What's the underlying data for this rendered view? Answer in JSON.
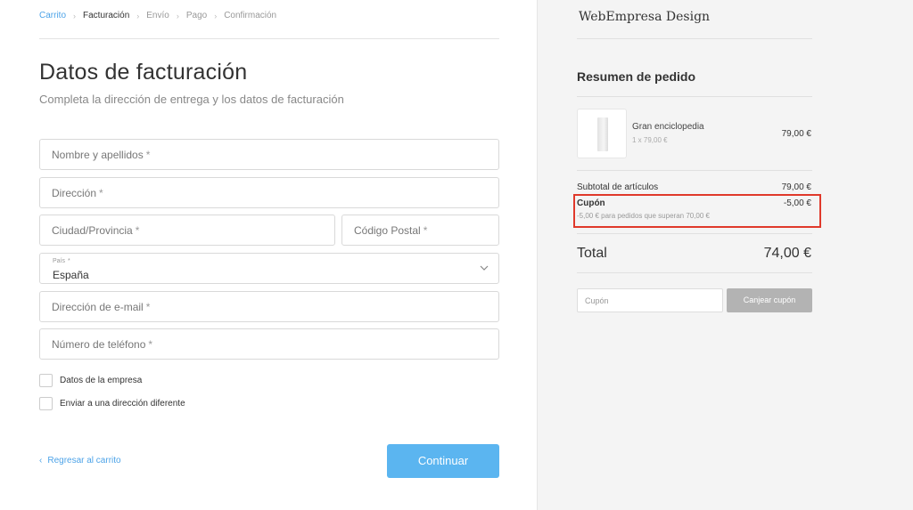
{
  "breadcrumb": {
    "items": [
      {
        "label": "Carrito",
        "state": "link"
      },
      {
        "label": "Facturación",
        "state": "current"
      },
      {
        "label": "Envío",
        "state": "inactive"
      },
      {
        "label": "Pago",
        "state": "inactive"
      },
      {
        "label": "Confirmación",
        "state": "inactive"
      }
    ],
    "separator": "›"
  },
  "form": {
    "title": "Datos de facturación",
    "subtitle": "Completa la dirección de entrega y los datos de facturación",
    "required_mark": "*",
    "fields": {
      "name": "Nombre y apellidos",
      "address": "Dirección",
      "city": "Ciudad/Provincia",
      "postal": "Código Postal",
      "country_label": "País",
      "country_value": "España",
      "email": "Dirección de e-mail",
      "phone": "Número de teléfono"
    },
    "checkboxes": {
      "company": "Datos de la empresa",
      "different_address": "Enviar a una dirección diferente"
    },
    "back_link": "Regresar al carrito",
    "back_chevron": "‹",
    "continue_button": "Continuar"
  },
  "summary": {
    "brand": "WebEmpresa Design",
    "title": "Resumen de pedido",
    "product": {
      "name": "Gran enciclopedia",
      "qty_line": "1 x 79,00 €",
      "price": "79,00 €"
    },
    "subtotal_label": "Subtotal de artículos",
    "subtotal_value": "79,00 €",
    "coupon_label": "Cupón",
    "coupon_value": "-5,00 €",
    "coupon_desc": "-5,00 € para pedidos que superan 70,00 €",
    "total_label": "Total",
    "total_value": "74,00 €",
    "coupon_placeholder": "Cupón",
    "redeem_button": "Canjear cupón"
  },
  "colors": {
    "accent": "#4da3e8",
    "continue_bg": "#5bb5f0",
    "highlight_border": "#e0392b",
    "panel_bg": "#f4f4f4",
    "redeem_bg": "#b3b3b3"
  },
  "icons": {
    "country_dropdown": "chevron-down-icon",
    "breadcrumb_separator": "chevron-right-icon",
    "back_link": "chevron-left-icon"
  }
}
